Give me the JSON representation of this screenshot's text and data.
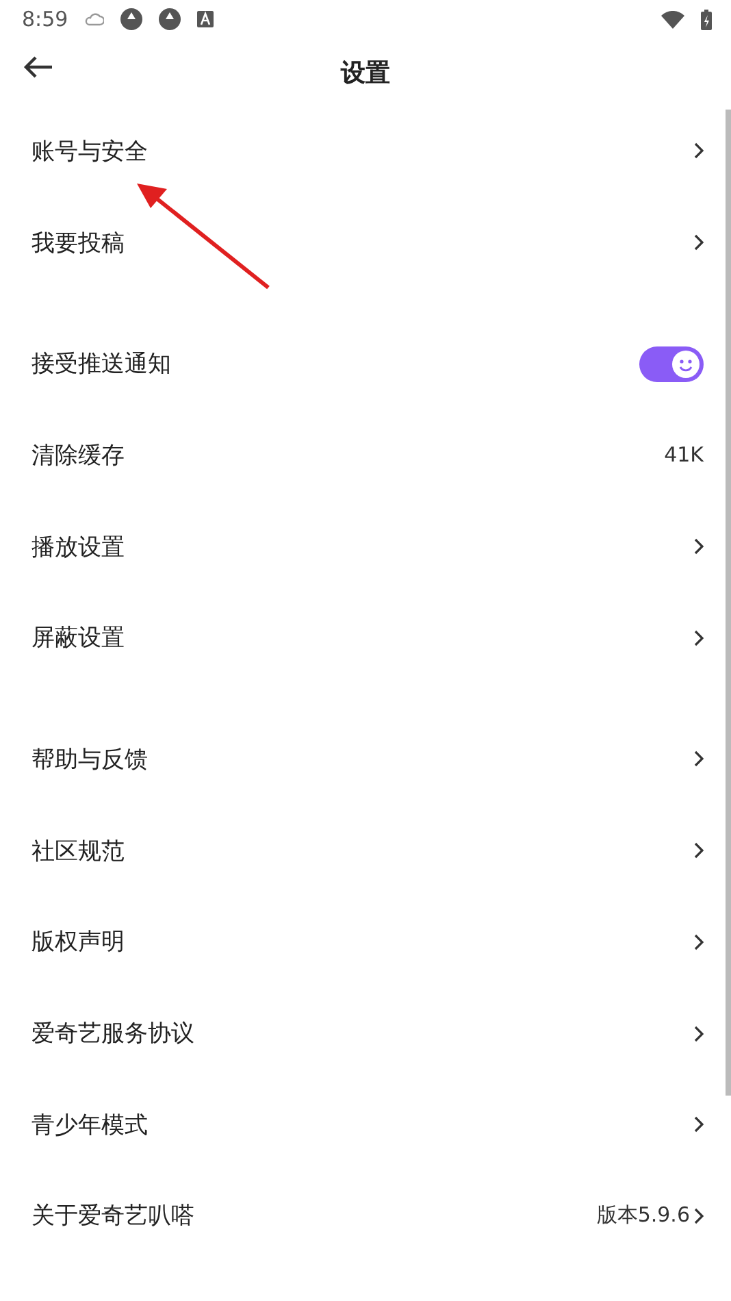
{
  "status_bar": {
    "time": "8:59"
  },
  "header": {
    "title": "设置"
  },
  "sections": [
    {
      "items": [
        {
          "kind": "link",
          "label": "账号与安全"
        },
        {
          "kind": "link",
          "label": "我要投稿"
        }
      ]
    },
    {
      "items": [
        {
          "kind": "toggle",
          "label": "接受推送通知",
          "on": true
        },
        {
          "kind": "value",
          "label": "清除缓存",
          "value": "41K"
        },
        {
          "kind": "link",
          "label": "播放设置"
        },
        {
          "kind": "link",
          "label": "屏蔽设置"
        }
      ]
    },
    {
      "items": [
        {
          "kind": "link",
          "label": "帮助与反馈"
        },
        {
          "kind": "link",
          "label": "社区规范"
        },
        {
          "kind": "link",
          "label": "版权声明"
        },
        {
          "kind": "link",
          "label": "爱奇艺服务协议"
        },
        {
          "kind": "link",
          "label": "青少年模式"
        },
        {
          "kind": "value_link",
          "label": "关于爱奇艺叭嗒",
          "value": "版本5.9.6"
        }
      ]
    }
  ]
}
